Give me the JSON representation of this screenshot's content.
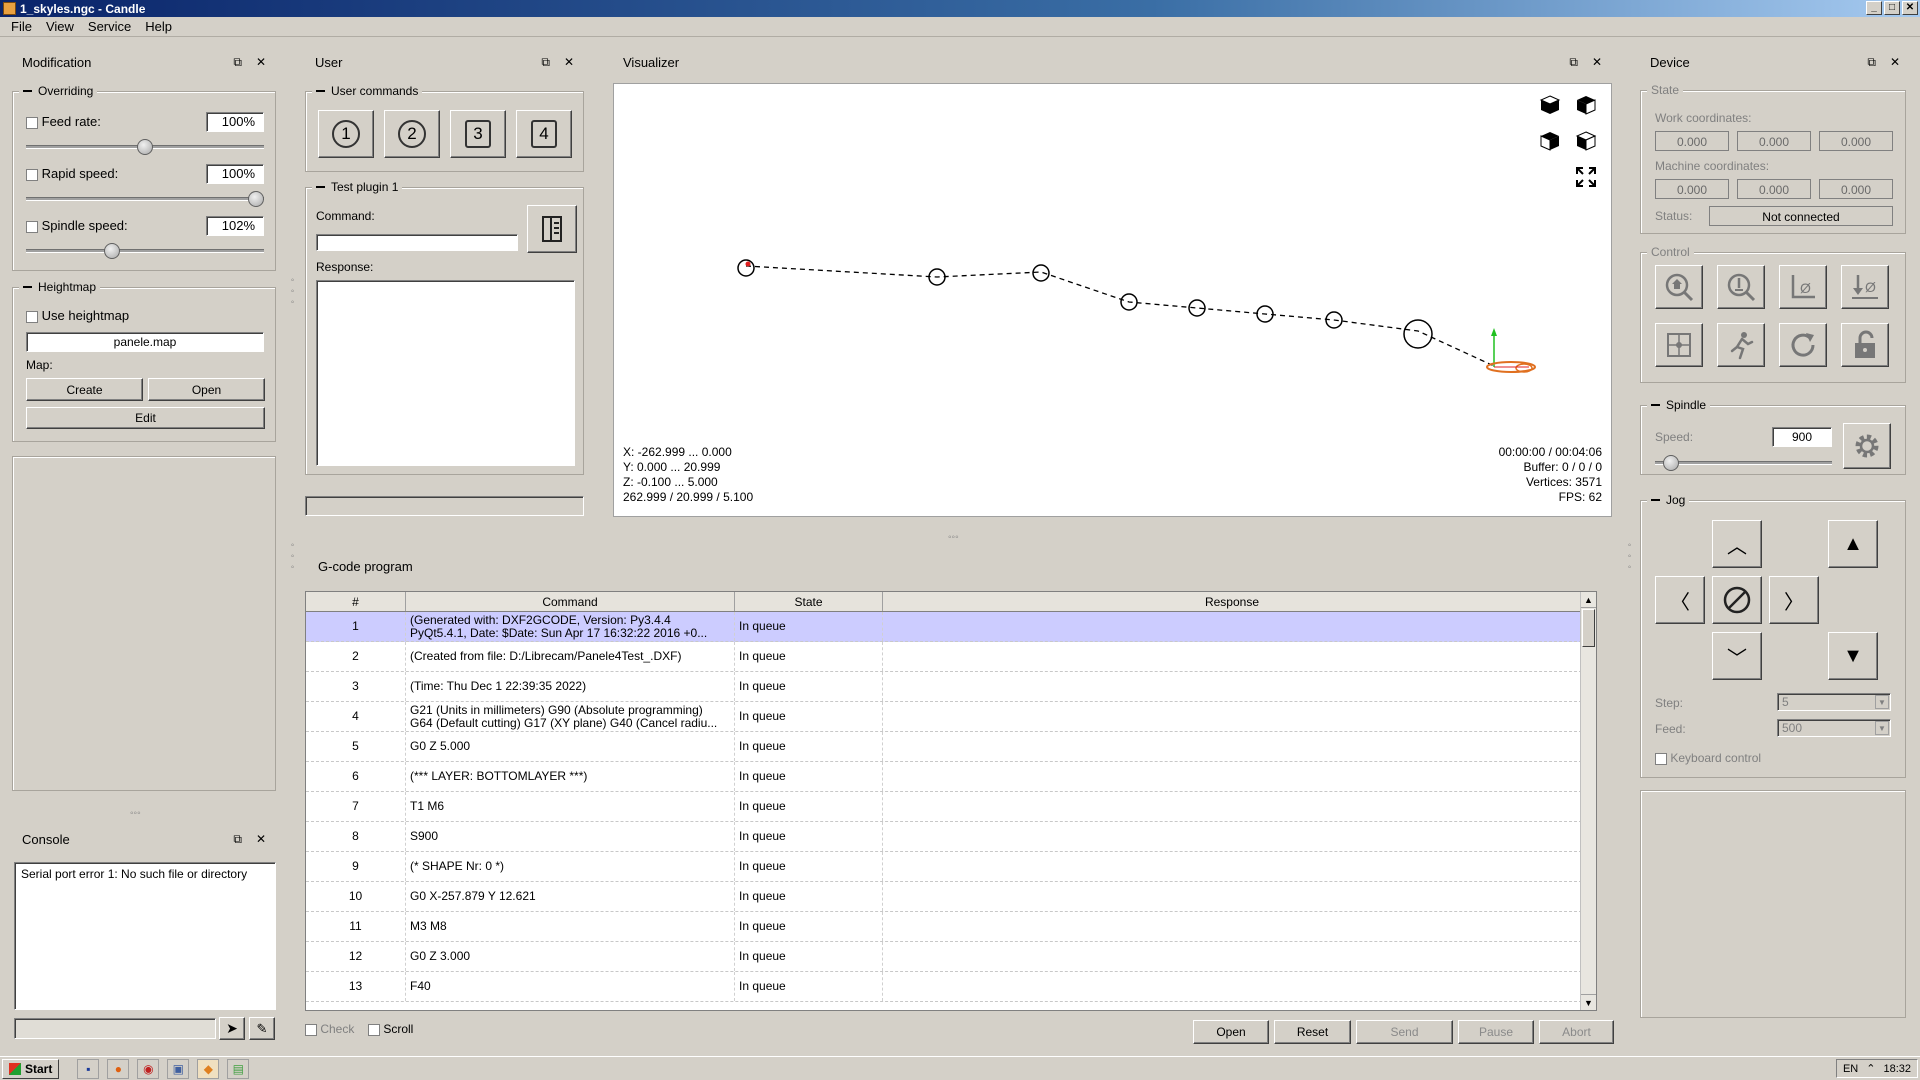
{
  "window": {
    "title": "1_skyles.ngc - Candle",
    "minimize": "_",
    "maximize": "□",
    "close": "✕"
  },
  "menu": [
    "File",
    "View",
    "Service",
    "Help"
  ],
  "modification": {
    "title": "Modification",
    "overriding_title": "Overriding",
    "feed_rate_label": "Feed rate:",
    "feed_rate_value": "100%",
    "feed_rate_level": 0.5,
    "rapid_speed_label": "Rapid speed:",
    "rapid_speed_value": "100%",
    "rapid_speed_level": 1.0,
    "spindle_speed_label": "Spindle speed:",
    "spindle_speed_value": "102%",
    "spindle_speed_level": 0.35,
    "heightmap_title": "Heightmap",
    "use_heightmap_label": "Use heightmap",
    "heightmap_file": "panele.map",
    "map_label": "Map:",
    "create_label": "Create",
    "open_label": "Open",
    "edit_label": "Edit"
  },
  "console": {
    "title": "Console",
    "text": "Serial port error 1: No such file or directory"
  },
  "user": {
    "title": "User",
    "commands_title": "User commands",
    "buttons": [
      "1",
      "2",
      "3",
      "4"
    ],
    "plugin_title": "Test plugin 1",
    "command_label": "Command:",
    "response_label": "Response:"
  },
  "visualizer": {
    "title": "Visualizer",
    "x_range": "X: -262.999 ... 0.000",
    "y_range": "Y: 0.000 ... 20.999",
    "z_range": "Z: -0.100 ... 5.000",
    "dims": "262.999 / 20.999 / 5.100",
    "time": "00:00:00 / 00:04:06",
    "buffer": "Buffer: 0 / 0 / 0",
    "vertices": "Vertices: 3571",
    "fps": "FPS: 62"
  },
  "gcode": {
    "title": "G-code program",
    "headers": [
      "#",
      "Command",
      "State",
      "Response"
    ],
    "rows": [
      {
        "n": "1",
        "cmd1": "(Generated with: DXF2GCODE, Version: Py3.4.4",
        "cmd2": "PyQt5.4.1, Date: $Date: Sun Apr 17 16:32:22 2016 +0...",
        "state": "In queue"
      },
      {
        "n": "2",
        "cmd1": "(Created from file: D:/Librecam/Panele4Test_.DXF)",
        "cmd2": "",
        "state": "In queue"
      },
      {
        "n": "3",
        "cmd1": "(Time: Thu Dec  1 22:39:35 2022)",
        "cmd2": "",
        "state": "In queue"
      },
      {
        "n": "4",
        "cmd1": "G21 (Units in millimeters)  G90 (Absolute programming)",
        "cmd2": "G64 (Default cutting) G17 (XY plane) G40 (Cancel radiu...",
        "state": "In queue"
      },
      {
        "n": "5",
        "cmd1": "G0 Z   5.000",
        "cmd2": "",
        "state": "In queue"
      },
      {
        "n": "6",
        "cmd1": "(*** LAYER: BOTTOMLAYER ***)",
        "cmd2": "",
        "state": "In queue"
      },
      {
        "n": "7",
        "cmd1": "T1 M6",
        "cmd2": "",
        "state": "In queue"
      },
      {
        "n": "8",
        "cmd1": "S900",
        "cmd2": "",
        "state": "In queue"
      },
      {
        "n": "9",
        "cmd1": "(* SHAPE Nr: 0 *)",
        "cmd2": "",
        "state": "In queue"
      },
      {
        "n": "10",
        "cmd1": "G0 X-257.879 Y  12.621",
        "cmd2": "",
        "state": "In queue"
      },
      {
        "n": "11",
        "cmd1": "M3 M8",
        "cmd2": "",
        "state": "In queue"
      },
      {
        "n": "12",
        "cmd1": "G0 Z   3.000",
        "cmd2": "",
        "state": "In queue"
      },
      {
        "n": "13",
        "cmd1": "F40",
        "cmd2": "",
        "state": "In queue"
      }
    ],
    "check_label": "Check",
    "scroll_label": "Scroll",
    "open_label": "Open",
    "reset_label": "Reset",
    "send_label": "Send",
    "pause_label": "Pause",
    "abort_label": "Abort"
  },
  "device": {
    "title": "Device",
    "state_title": "State",
    "work_coords_label": "Work coordinates:",
    "work_coords": [
      "0.000",
      "0.000",
      "0.000"
    ],
    "machine_coords_label": "Machine coordinates:",
    "machine_coords": [
      "0.000",
      "0.000",
      "0.000"
    ],
    "status_label": "Status:",
    "status_value": "Not connected",
    "control_title": "Control",
    "spindle_title": "Spindle",
    "speed_label": "Speed:",
    "speed_value": "900",
    "jog_title": "Jog",
    "step_label": "Step:",
    "step_value": "5",
    "feed_label": "Feed:",
    "feed_value": "500",
    "keyboard_label": "Keyboard control"
  },
  "taskbar": {
    "start_label": "Start",
    "lang": "EN",
    "clock": "18:32"
  }
}
